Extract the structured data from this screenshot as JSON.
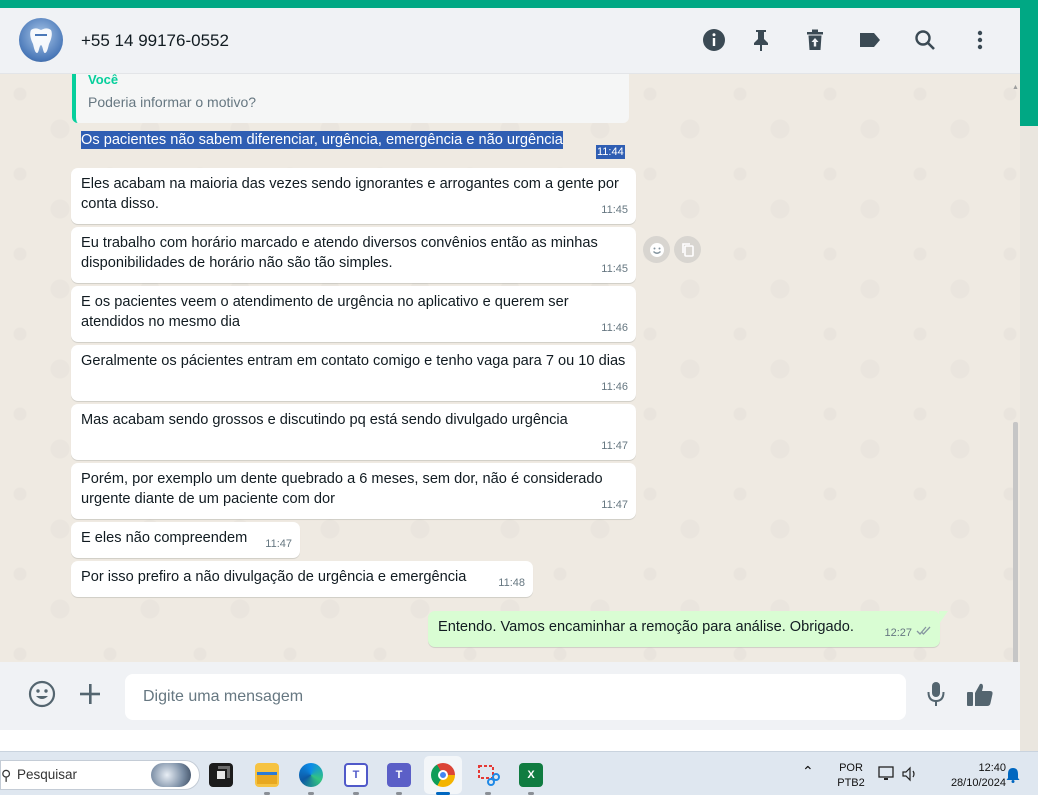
{
  "header": {
    "contact": "+55 14 99176-0552",
    "icons": [
      "info-icon",
      "pin-icon",
      "delete-icon",
      "label-icon",
      "search-icon",
      "menu-icon"
    ]
  },
  "quote": {
    "author": "Você",
    "text": "Poderia informar o motivo?"
  },
  "messages": [
    {
      "text": "Os pacientes não sabem diferenciar, urgência, emergência e não urgência",
      "time": "11:44"
    },
    {
      "text": "Eles acabam na maioria das vezes sendo ignorantes e arrogantes com a gente por conta disso.",
      "time": "11:45"
    },
    {
      "text": "Eu trabalho com horário marcado e atendo diversos convênios então as minhas disponibilidades de horário não são tão simples.",
      "time": "11:45"
    },
    {
      "text": "E os pacientes veem o atendimento de urgência no aplicativo e querem ser atendidos no mesmo dia",
      "time": "11:46"
    },
    {
      "text": "Geralmente os pácientes entram em contato comigo e tenho vaga para 7 ou 10 dias",
      "time": "11:46"
    },
    {
      "text": "Mas acabam sendo grossos e discutindo pq está sendo divulgado urgência",
      "time": "11:47"
    },
    {
      "text": "Porém, por exemplo um dente quebrado a 6 meses, sem dor, não é considerado urgente diante de um paciente com dor",
      "time": "11:47"
    },
    {
      "text": "E eles não compreendem",
      "time": "11:47"
    },
    {
      "text": "Por isso prefiro a não divulgação de urgência e emergência",
      "time": "11:48"
    }
  ],
  "outgoing": {
    "text": "Entendo. Vamos encaminhar a remoção para análise. Obrigado.",
    "time": "12:27",
    "status": "read-double-check"
  },
  "footer": {
    "placeholder": "Digite uma mensagem",
    "icons": [
      "emoji-icon",
      "attach-plus-icon",
      "microphone-icon",
      "thumbs-up-icon"
    ]
  },
  "taskbar": {
    "search_label": "Pesquisar",
    "lang_top": "POR",
    "lang_bottom": "PTB2",
    "time": "12:40",
    "date": "28/10/2024",
    "apps": [
      "task-view",
      "file-explorer",
      "edge",
      "teams-classroom",
      "teams",
      "chrome",
      "snipping-tool",
      "excel"
    ]
  },
  "colors": {
    "accent": "#00a884",
    "incoming": "#ffffff",
    "outgoing": "#d9fdd3",
    "selection": "#2f5eb3"
  }
}
